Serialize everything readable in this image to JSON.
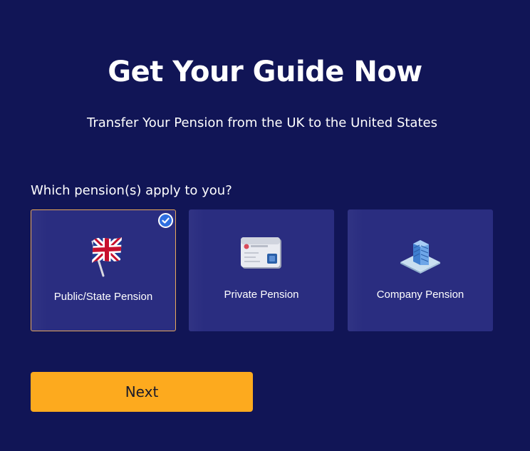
{
  "header": {
    "title": "Get Your Guide Now",
    "subtitle": "Transfer Your Pension from the UK to the United States"
  },
  "form": {
    "question": "Which pension(s) apply to you?",
    "options": [
      {
        "label": "Public/State Pension",
        "icon": "uk-flag-icon",
        "selected": true
      },
      {
        "label": "Private Pension",
        "icon": "bank-card-icon",
        "selected": false
      },
      {
        "label": "Company Pension",
        "icon": "office-building-icon",
        "selected": false
      }
    ],
    "next_label": "Next"
  },
  "colors": {
    "background": "#111556",
    "card": "#2a2d80",
    "selected_border": "#e8a85a",
    "check": "#2f6fe0",
    "button": "#fdaa1e"
  }
}
